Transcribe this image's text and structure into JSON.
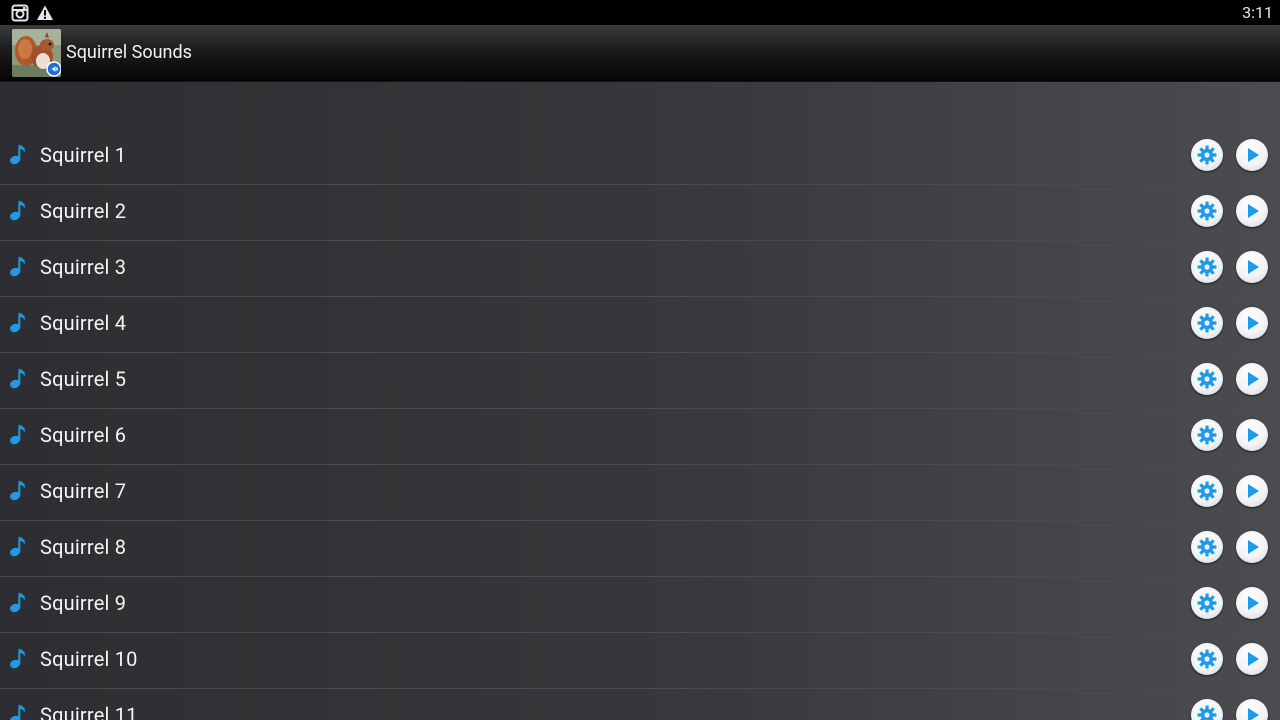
{
  "status_bar": {
    "time": "3:11",
    "icons": [
      "instagram-icon",
      "warning-icon"
    ]
  },
  "action_bar": {
    "title": "Squirrel Sounds",
    "icon": "squirrel-app-icon"
  },
  "list": {
    "items": [
      {
        "label": "Squirrel 1"
      },
      {
        "label": "Squirrel 2"
      },
      {
        "label": "Squirrel 3"
      },
      {
        "label": "Squirrel 4"
      },
      {
        "label": "Squirrel 5"
      },
      {
        "label": "Squirrel 6"
      },
      {
        "label": "Squirrel 7"
      },
      {
        "label": "Squirrel 8"
      },
      {
        "label": "Squirrel 9"
      },
      {
        "label": "Squirrel 10"
      },
      {
        "label": "Squirrel 11"
      }
    ],
    "item_icons": {
      "leading": "music-note-icon",
      "settings": "gear-icon",
      "play": "play-icon"
    }
  },
  "colors": {
    "accent": "#1e9be8",
    "background": "#36373a",
    "action_bar": "#0a0a0a"
  }
}
